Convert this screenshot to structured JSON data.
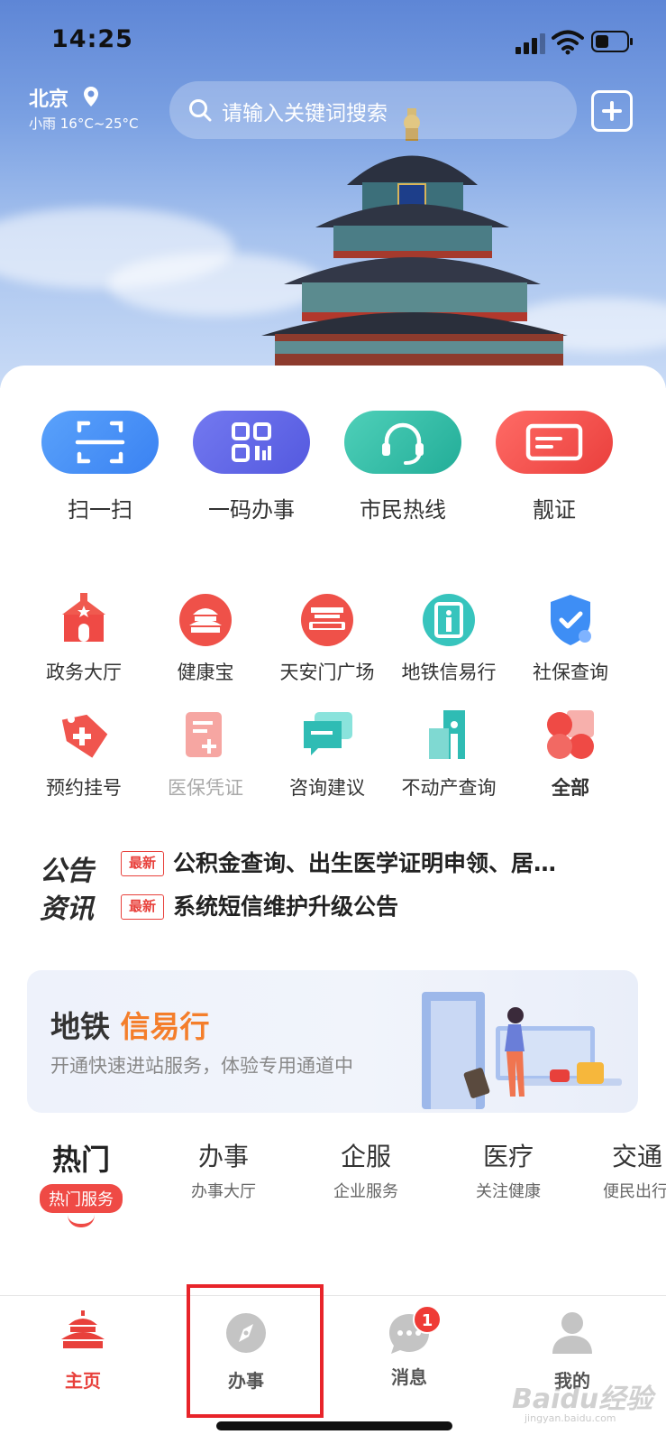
{
  "status": {
    "time": "14:25"
  },
  "header": {
    "city": "北京",
    "weather": "小雨 16°C~25°C",
    "search_placeholder": "请输入关键词搜索"
  },
  "quick_actions": [
    {
      "label": "扫一扫",
      "icon": "scan-icon",
      "color": "#3f8ef7"
    },
    {
      "label": "一码办事",
      "icon": "qr-code-icon",
      "color": "#5d62e6"
    },
    {
      "label": "市民热线",
      "icon": "headset-icon",
      "color": "#2fbfa7"
    },
    {
      "label": "靓证",
      "icon": "card-icon",
      "color": "#f2504d"
    }
  ],
  "services": [
    {
      "label": "政务大厅",
      "icon": "government-hall-icon"
    },
    {
      "label": "健康宝",
      "icon": "health-kit-icon"
    },
    {
      "label": "天安门广场",
      "icon": "tiananmen-icon"
    },
    {
      "label": "地铁信易行",
      "icon": "subway-gate-icon"
    },
    {
      "label": "社保查询",
      "icon": "shield-check-icon"
    },
    {
      "label": "预约挂号",
      "icon": "medical-tag-icon"
    },
    {
      "label": "医保凭证",
      "icon": "medical-insurance-icon"
    },
    {
      "label": "咨询建议",
      "icon": "chat-icon"
    },
    {
      "label": "不动产查询",
      "icon": "building-icon"
    },
    {
      "label": "全部",
      "icon": "all-apps-icon"
    }
  ],
  "notice": {
    "brand": "公告\n资讯",
    "tag": "最新",
    "items": [
      "公积金查询、出生医学证明申领、居…",
      "系统短信维护升级公告"
    ]
  },
  "banner": {
    "title_main": "地铁",
    "title_accent": "信易行",
    "subtitle": "开通快速进站服务，体验专用通道中"
  },
  "categories": [
    {
      "title": "热门",
      "sub": "热门服务"
    },
    {
      "title": "办事",
      "sub": "办事大厅"
    },
    {
      "title": "企服",
      "sub": "企业服务"
    },
    {
      "title": "医疗",
      "sub": "关注健康"
    },
    {
      "title": "交通",
      "sub": "便民出行"
    }
  ],
  "tabbar": {
    "items": [
      {
        "label": "主页",
        "icon": "temple-home-icon"
      },
      {
        "label": "办事",
        "icon": "compass-icon"
      },
      {
        "label": "消息",
        "icon": "message-icon",
        "badge": "1"
      },
      {
        "label": "我的",
        "icon": "person-icon"
      }
    ]
  },
  "watermark": {
    "text": "Baidu经验",
    "sub": "jingyan.baidu.com"
  },
  "colors": {
    "accent": "#e8403b",
    "orange": "#f47e2b"
  }
}
